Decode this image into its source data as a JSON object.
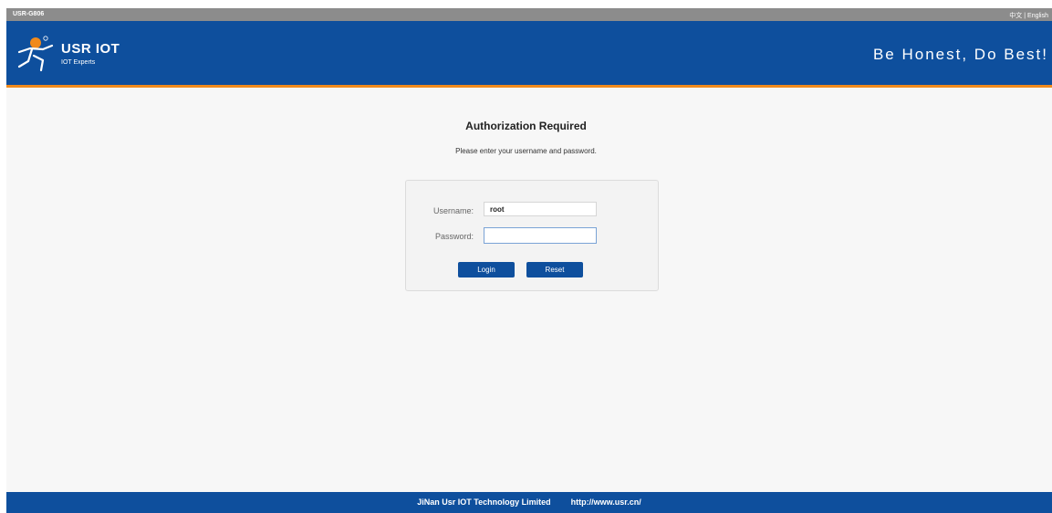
{
  "topbar": {
    "model": "USR-G806",
    "lang_cn": "中文",
    "lang_sep": "|",
    "lang_en": "English"
  },
  "header": {
    "brand": "USR IOT",
    "tagline": "IOT Experts",
    "slogan": "Be Honest, Do Best!"
  },
  "auth": {
    "title": "Authorization Required",
    "subtitle": "Please enter your username and password.",
    "username_label": "Username:",
    "username_value": "root",
    "password_label": "Password:",
    "password_value": "",
    "login_label": "Login",
    "reset_label": "Reset"
  },
  "footer": {
    "company": "JiNan Usr IOT Technology Limited",
    "url": "http://www.usr.cn/"
  },
  "colors": {
    "primary": "#0e4f9d",
    "accent": "#f08a1c",
    "topbar": "#8c8c8c"
  },
  "icons": {
    "logo": "usr-running-man-icon"
  }
}
